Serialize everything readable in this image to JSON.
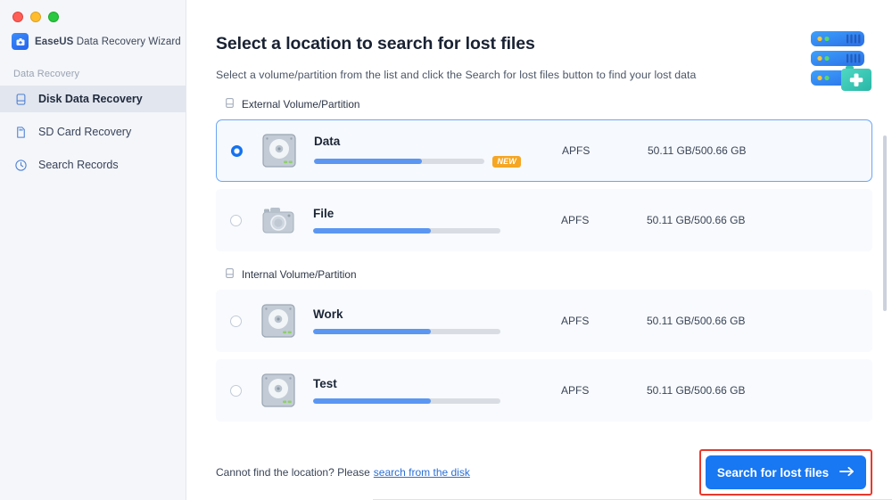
{
  "window": {
    "traffic_lights": [
      "close",
      "minimize",
      "maximize"
    ],
    "brand_name_bold": "EaseUS",
    "brand_name_rest": "Data Recovery Wizard"
  },
  "sidebar": {
    "section_label": "Data Recovery",
    "items": [
      {
        "label": "Disk Data Recovery",
        "icon": "hard-drive-icon",
        "active": true
      },
      {
        "label": "SD Card Recovery",
        "icon": "sd-card-icon",
        "active": false
      },
      {
        "label": "Search Records",
        "icon": "clock-icon",
        "active": false
      }
    ]
  },
  "header": {
    "title": "Select a location to search for lost files",
    "subtitle": "Select a volume/partition from the list and click the Search for lost files button to find your lost data",
    "art_icon": "server-stack-with-first-aid-kit-icon"
  },
  "groups": [
    {
      "label": "External Volume/Partition",
      "icon": "drive-outline-icon",
      "volumes": [
        {
          "name": "Data",
          "icon": "hard-disk-icon",
          "selected": true,
          "badge": "NEW",
          "usage_percent": 63,
          "filesystem": "APFS",
          "size": "50.11 GB/500.66 GB"
        },
        {
          "name": "File",
          "icon": "camera-icon",
          "selected": false,
          "badge": "",
          "usage_percent": 63,
          "filesystem": "APFS",
          "size": "50.11 GB/500.66 GB"
        }
      ]
    },
    {
      "label": "Internal Volume/Partition",
      "icon": "drive-outline-icon",
      "volumes": [
        {
          "name": "Work",
          "icon": "hard-disk-icon",
          "selected": false,
          "badge": "",
          "usage_percent": 63,
          "filesystem": "APFS",
          "size": "50.11 GB/500.66 GB"
        },
        {
          "name": "Test",
          "icon": "hard-disk-icon",
          "selected": false,
          "badge": "",
          "usage_percent": 63,
          "filesystem": "APFS",
          "size": "50.11 GB/500.66 GB"
        }
      ]
    }
  ],
  "footer": {
    "note_text": "Cannot find the location? Please",
    "link_text": "search from the disk",
    "cta_label": "Search for lost files",
    "cta_icon": "arrow-right-icon",
    "cta_highlight_color": "#e8392c",
    "cta_color": "#1877f2"
  }
}
